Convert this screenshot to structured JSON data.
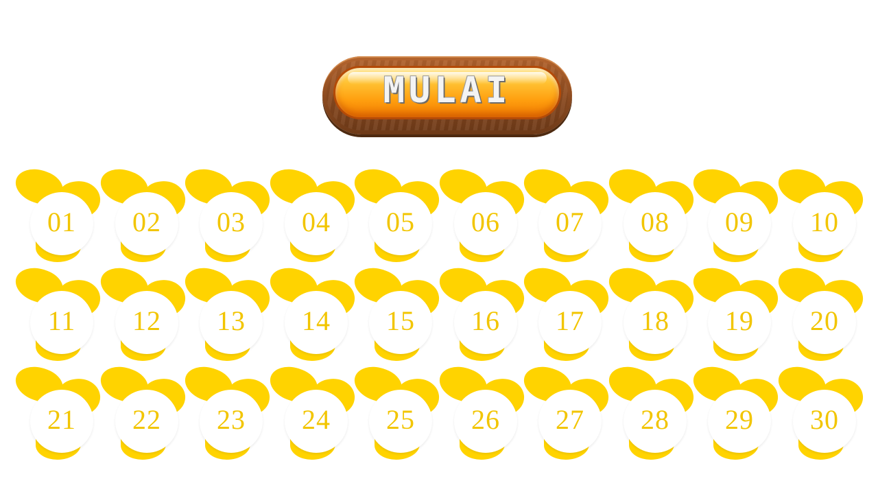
{
  "start_button": {
    "label": "MULAI"
  },
  "tiles": [
    "01",
    "02",
    "03",
    "04",
    "05",
    "06",
    "07",
    "08",
    "09",
    "10",
    "11",
    "12",
    "13",
    "14",
    "15",
    "16",
    "17",
    "18",
    "19",
    "20",
    "21",
    "22",
    "23",
    "24",
    "25",
    "26",
    "27",
    "28",
    "29",
    "30"
  ],
  "colors": {
    "petal": "#ffd300",
    "number": "#f2c500",
    "button_orange": "#ff9f0f",
    "button_wood": "#8a4a20"
  }
}
